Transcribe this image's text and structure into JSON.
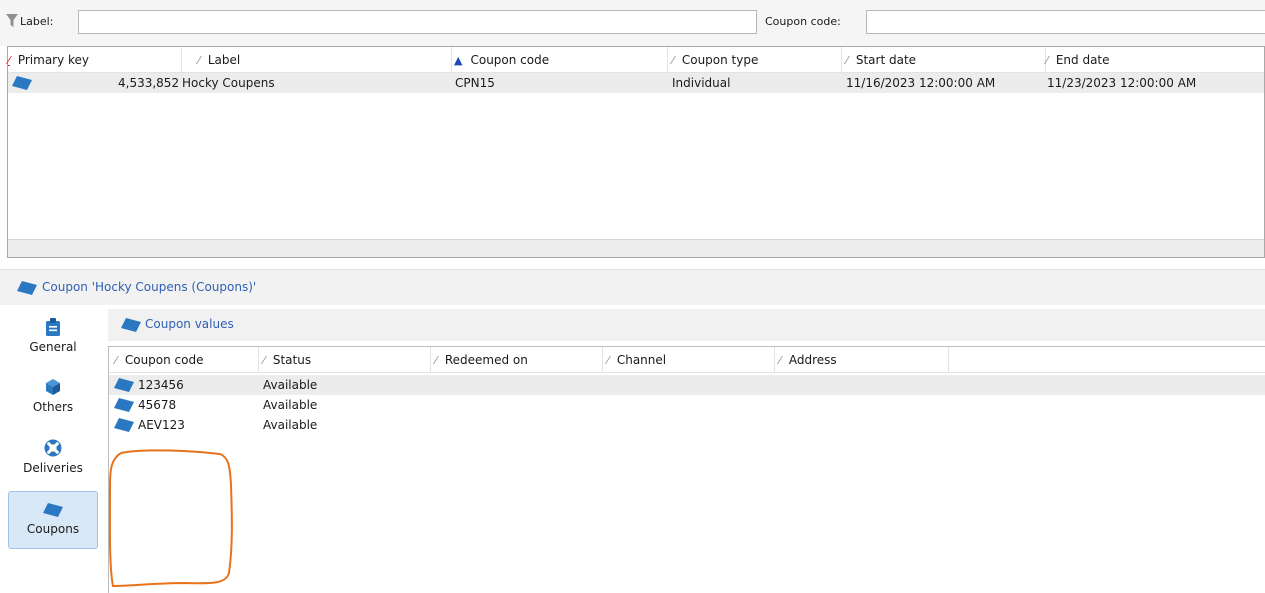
{
  "filter": {
    "label_text": "Label:",
    "label_value": "",
    "code_text": "Coupon code:",
    "code_value": ""
  },
  "top_grid": {
    "columns": [
      "Primary key",
      "Label",
      "Coupon code",
      "Coupon type",
      "Start date",
      "End date"
    ],
    "rows": [
      {
        "primary_key": "4,533,852",
        "label": "Hocky Coupens",
        "coupon_code": "CPN15",
        "coupon_type": "Individual",
        "start_date": "11/16/2023 12:00:00 AM",
        "end_date": "11/23/2023 12:00:00 AM"
      }
    ]
  },
  "detail": {
    "title": "Coupon 'Hocky Coupens (Coupons)'",
    "tabs": [
      {
        "label": "General",
        "icon": "clipboard-icon"
      },
      {
        "label": "Others",
        "icon": "cube-icon"
      },
      {
        "label": "Deliveries",
        "icon": "lifebuoy-icon"
      },
      {
        "label": "Coupons",
        "icon": "coupon-icon",
        "active": true
      }
    ],
    "section_title": "Coupon values",
    "columns": [
      "Coupon code",
      "Status",
      "Redeemed on",
      "Channel",
      "Address"
    ],
    "rows": [
      {
        "code": "123456",
        "status": "Available"
      },
      {
        "code": "45678",
        "status": "Available"
      },
      {
        "code": "AEV123",
        "status": "Available"
      }
    ]
  },
  "colors": {
    "accent_blue": "#2f5fb3",
    "icon_blue": "#2b78c2",
    "annotation_orange": "#e8731a",
    "active_tab_bg": "#d9e8f7"
  }
}
